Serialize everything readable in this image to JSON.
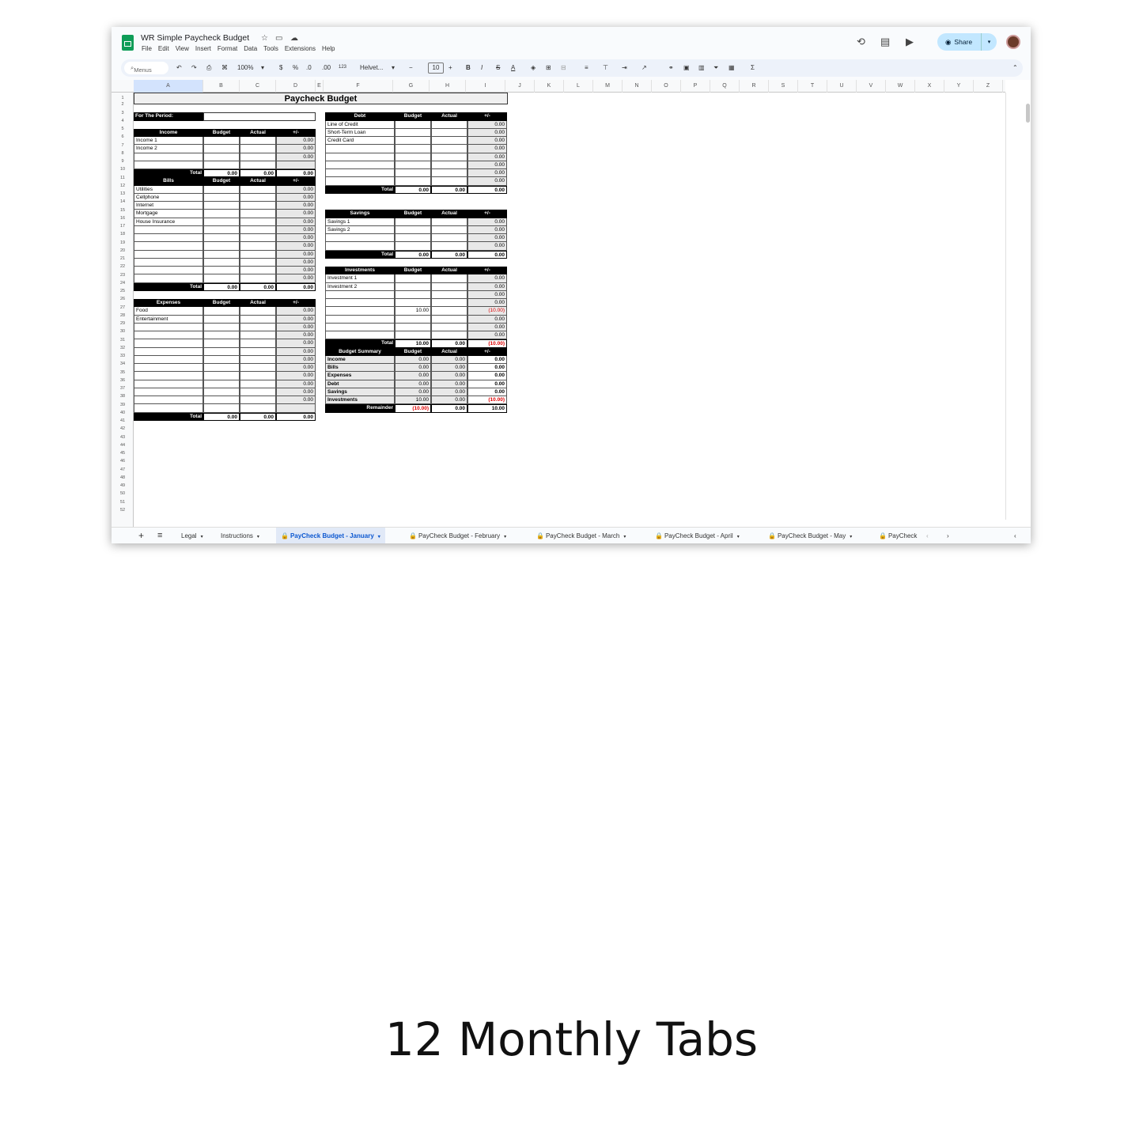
{
  "app": {
    "title": "WR Simple Paycheck Budget",
    "menu": [
      "File",
      "Edit",
      "View",
      "Insert",
      "Format",
      "Data",
      "Tools",
      "Extensions",
      "Help"
    ],
    "share_label": "Share"
  },
  "toolbar": {
    "search_placeholder": "Menus",
    "zoom": "100%",
    "currency": "$",
    "percent": "%",
    "dec_less": ".0",
    "dec_more": ".00",
    "format_123": "123",
    "font": "Helvet...",
    "font_size": "10",
    "bold": "B",
    "italic": "I",
    "strike": "S",
    "text_color": "A",
    "sigma": "Σ"
  },
  "columns": [
    "A",
    "B",
    "C",
    "D",
    "E",
    "F",
    "G",
    "H",
    "I",
    "J",
    "K",
    "L",
    "M",
    "N",
    "O",
    "P",
    "Q",
    "R",
    "S",
    "T",
    "U",
    "V",
    "W",
    "X",
    "Y",
    "Z"
  ],
  "rows": [
    "1",
    "2",
    "3",
    "4",
    "5",
    "6",
    "7",
    "8",
    "9",
    "10",
    "11",
    "12",
    "13",
    "14",
    "15",
    "16",
    "17",
    "18",
    "19",
    "20",
    "21",
    "22",
    "23",
    "24",
    "25",
    "26",
    "27",
    "28",
    "29",
    "30",
    "31",
    "32",
    "33",
    "34",
    "35",
    "36",
    "37",
    "38",
    "39",
    "40",
    "41",
    "42",
    "43",
    "44",
    "45",
    "46",
    "47",
    "48",
    "49",
    "50",
    "51",
    "52"
  ],
  "sheet": {
    "title": "Paycheck Budget",
    "period_label": "For The Period:",
    "hdr": {
      "budget": "Budget",
      "actual": "Actual",
      "diff": "+/-",
      "total": "Total"
    },
    "income": {
      "title": "Income",
      "items": [
        "Income 1",
        "Income 2",
        "",
        ""
      ],
      "diffs": [
        "0.00",
        "0.00",
        "0.00"
      ],
      "total": [
        "0.00",
        "0.00",
        "0.00"
      ]
    },
    "bills": {
      "title": "Bills",
      "items": [
        "Utilities",
        "Cellphone",
        "Internet",
        "Mortgage",
        "House Insurance",
        "",
        "",
        "",
        "",
        "",
        "",
        ""
      ],
      "diffs": [
        "0.00",
        "0.00",
        "0.00",
        "0.00",
        "0.00",
        "0.00",
        "0.00",
        "0.00",
        "0.00",
        "0.00",
        "0.00",
        "0.00"
      ],
      "total": [
        "0.00",
        "0.00",
        "0.00"
      ]
    },
    "expenses": {
      "title": "Expenses",
      "items": [
        "Food",
        "Entertainment",
        "",
        "",
        "",
        "",
        "",
        "",
        "",
        "",
        "",
        "",
        ""
      ],
      "diffs": [
        "0.00",
        "0.00",
        "0.00",
        "0.00",
        "0.00",
        "0.00",
        "0.00",
        "0.00",
        "0.00",
        "0.00",
        "0.00",
        "0.00"
      ],
      "total": [
        "0.00",
        "0.00",
        "0.00"
      ]
    },
    "debt": {
      "title": "Debt",
      "items": [
        "Line of Credit",
        "Short-Term Loan",
        "Credit Card",
        "",
        "",
        "",
        "",
        ""
      ],
      "diffs": [
        "0.00",
        "0.00",
        "0.00",
        "0.00",
        "0.00",
        "0.00",
        "0.00",
        "0.00"
      ],
      "total": [
        "0.00",
        "0.00",
        "0.00"
      ]
    },
    "savings": {
      "title": "Savings",
      "items": [
        "Savings 1",
        "Savings 2",
        "",
        ""
      ],
      "diffs": [
        "0.00",
        "0.00",
        "0.00",
        "0.00"
      ],
      "total": [
        "0.00",
        "0.00",
        "0.00"
      ]
    },
    "investments": {
      "title": "Investments",
      "items": [
        "Investment 1",
        "Investment 2",
        "",
        "",
        "",
        "",
        "",
        ""
      ],
      "budgets": [
        "",
        "",
        "",
        "",
        "10.00",
        "",
        "",
        ""
      ],
      "diffs": [
        "0.00",
        "0.00",
        "0.00",
        "0.00",
        "(10.00)",
        "0.00",
        "0.00",
        "0.00"
      ],
      "total": [
        "10.00",
        "0.00",
        "(10.00)"
      ]
    },
    "summary": {
      "title": "Budget Summary",
      "rows": [
        {
          "label": "Income",
          "budget": "0.00",
          "actual": "0.00",
          "diff": "0.00"
        },
        {
          "label": "Bills",
          "budget": "0.00",
          "actual": "0.00",
          "diff": "0.00"
        },
        {
          "label": "Expenses",
          "budget": "0.00",
          "actual": "0.00",
          "diff": "0.00"
        },
        {
          "label": "Debt",
          "budget": "0.00",
          "actual": "0.00",
          "diff": "0.00"
        },
        {
          "label": "Savings",
          "budget": "0.00",
          "actual": "0.00",
          "diff": "0.00"
        },
        {
          "label": "Investments",
          "budget": "10.00",
          "actual": "0.00",
          "diff": "(10.00)"
        }
      ],
      "remainder": {
        "label": "Remainder",
        "budget": "(10.00)",
        "actual": "0.00",
        "diff": "10.00"
      }
    }
  },
  "tabs": [
    "Legal",
    "Instructions",
    "PayCheck Budget - January",
    "PayCheck Budget - February",
    "PayCheck Budget - March",
    "PayCheck Budget - April",
    "PayCheck Budget - May",
    "PayCheck"
  ],
  "caption": "12 Monthly Tabs",
  "colors": {
    "accent": "#0b57d0",
    "negative": "#e00000",
    "sheets_green": "#0f9d58"
  }
}
